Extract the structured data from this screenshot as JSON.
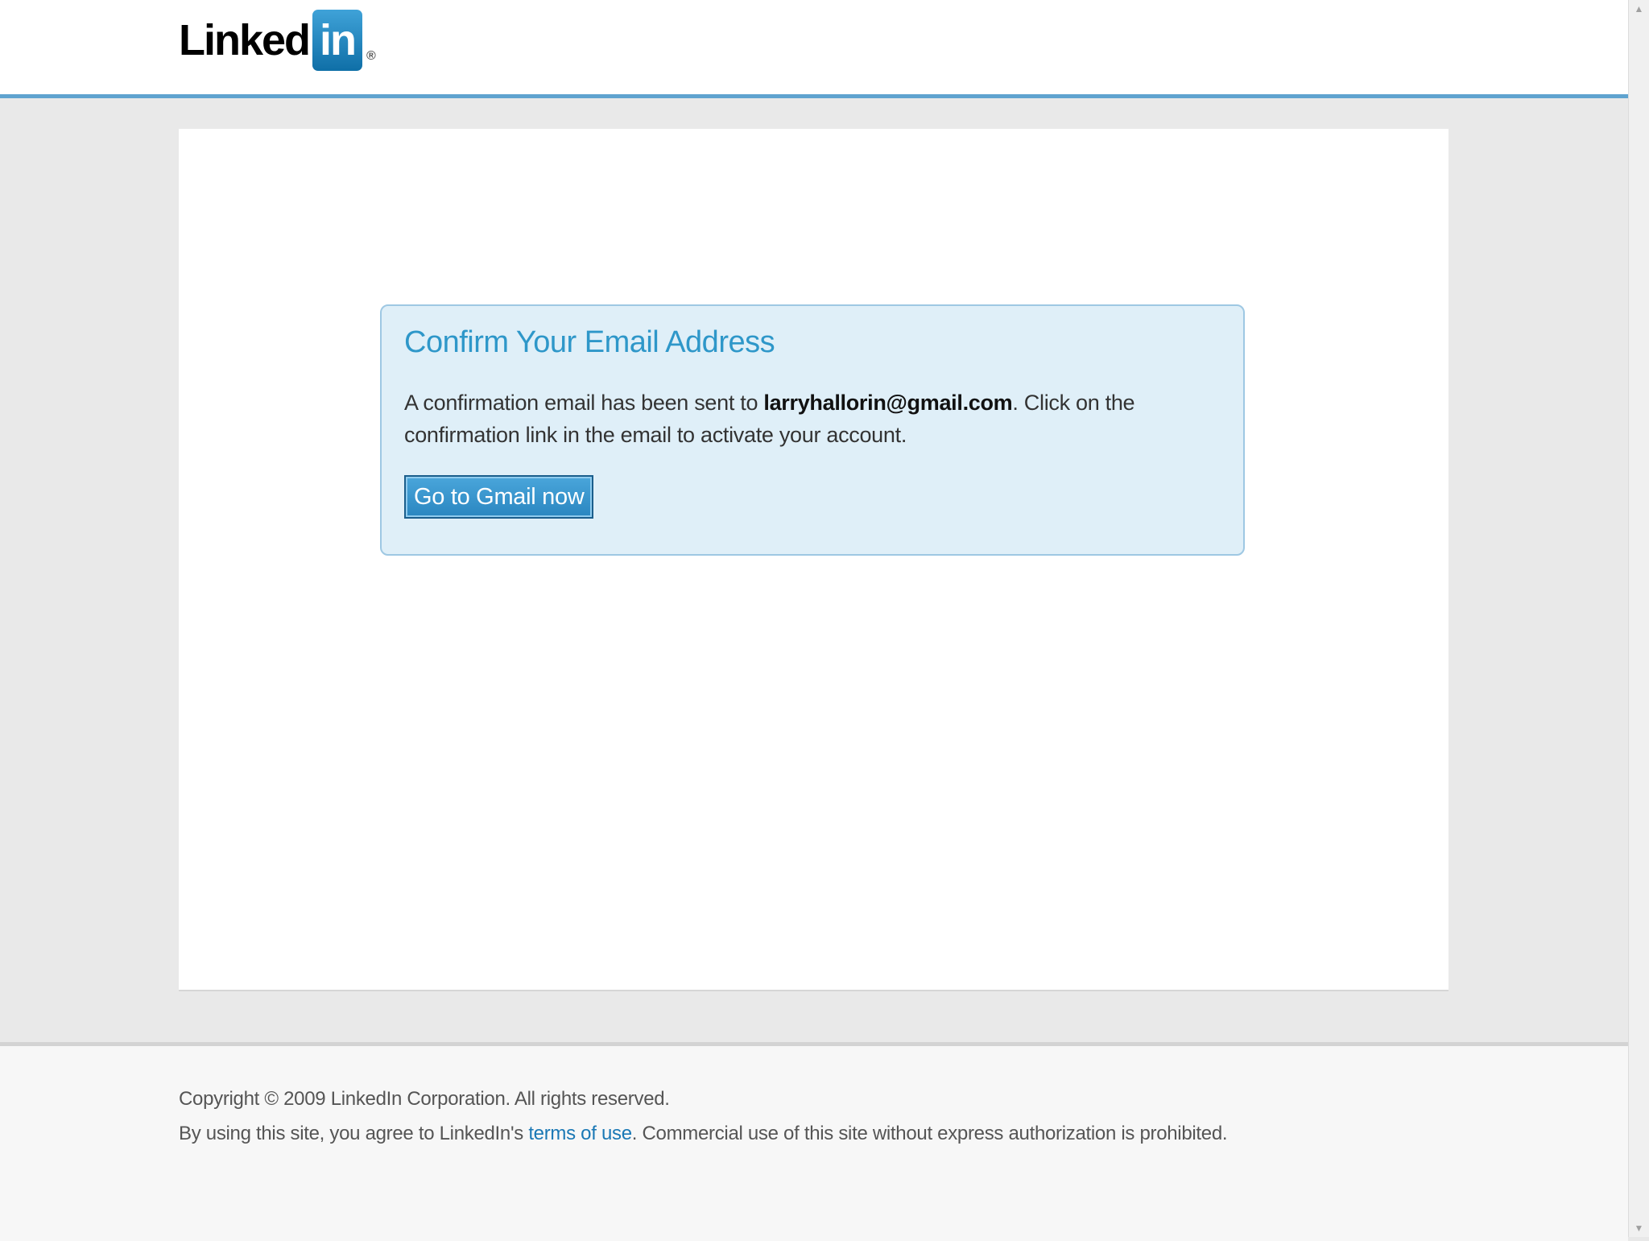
{
  "header": {
    "logo_text": "Linked",
    "logo_in": "in",
    "logo_reg": "®"
  },
  "confirm": {
    "title": "Confirm Your Email Address",
    "message_before": "A confirmation email has been sent to ",
    "email": "larryhallorin@gmail.com",
    "message_after": ". Click on the confirmation link in the email to activate your account.",
    "button_label": "Go to Gmail now"
  },
  "footer": {
    "copyright": "Copyright © 2009 LinkedIn Corporation. All rights reserved.",
    "terms_before": "By using this site, you agree to LinkedIn's ",
    "terms_link": "terms of use",
    "terms_after": ". Commercial use of this site without express authorization is prohibited."
  },
  "scrollbar": {
    "up_icon": "▲",
    "down_icon": "▼"
  },
  "colors": {
    "brand_blue": "#2e97c9",
    "header_rule": "#5fa3cf",
    "box_bg": "#dfeff8"
  }
}
